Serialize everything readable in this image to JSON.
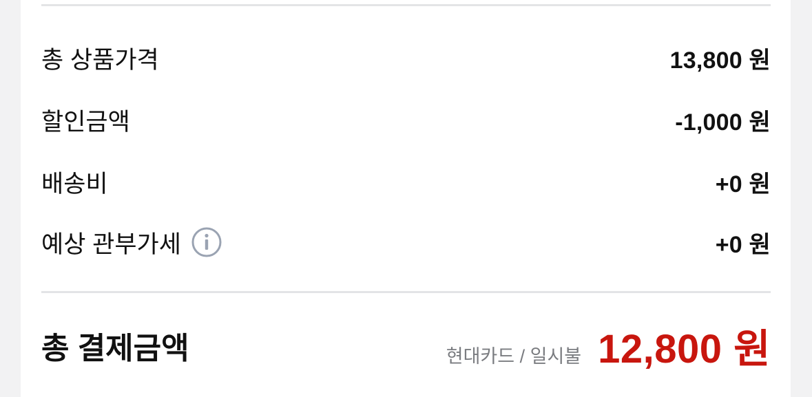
{
  "summary": {
    "rows": [
      {
        "label": "총 상품가격",
        "value": "13,800 원"
      },
      {
        "label": "할인금액",
        "value": "-1,000 원"
      },
      {
        "label": "배송비",
        "value": "+0 원"
      },
      {
        "label": "예상 관부가세",
        "value": "+0 원",
        "icon": "info-icon"
      }
    ],
    "total": {
      "label": "총 결제금액",
      "payment_method": "현대카드 / 일시불",
      "amount": "12,800 원"
    }
  },
  "colors": {
    "accent_red": "#c8160e",
    "text": "#111111",
    "muted": "#7a7c80",
    "divider": "#e3e4e6",
    "icon": "#9aa3b2"
  }
}
